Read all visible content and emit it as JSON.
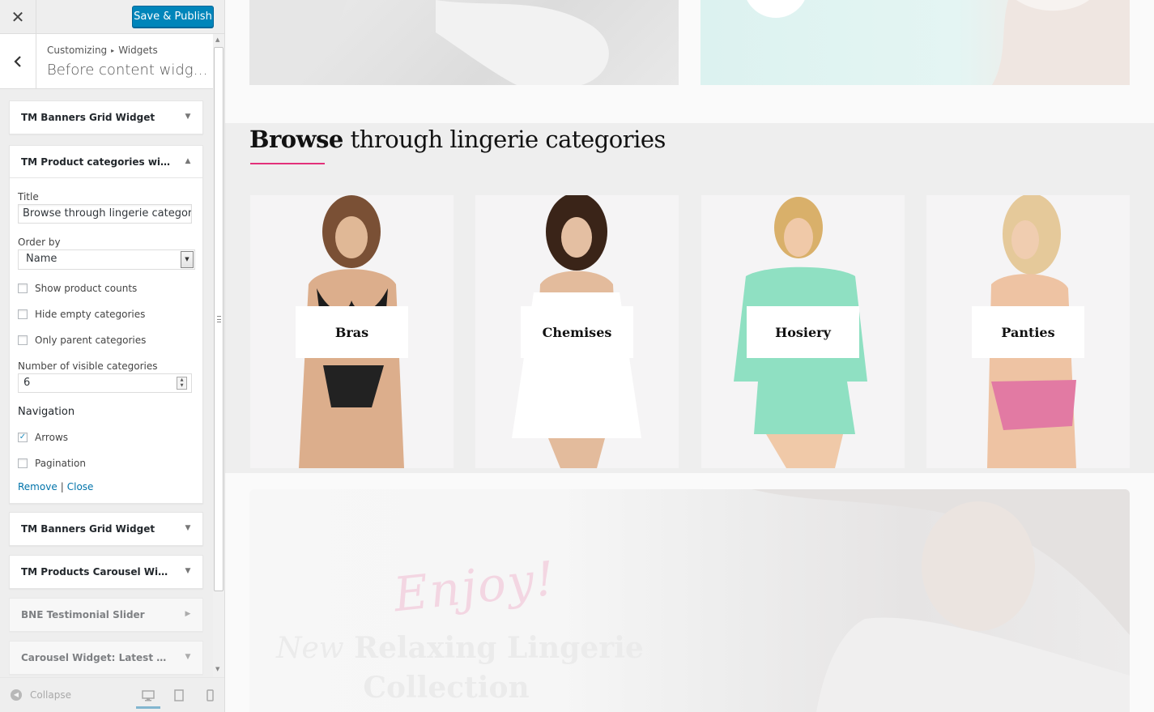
{
  "header": {
    "close_icon": "close-icon",
    "save_label": "Save & Publish"
  },
  "panel": {
    "breadcrumb_root": "Customizing",
    "breadcrumb_child": "Widgets",
    "title": "Before content widge..."
  },
  "widgets": [
    {
      "title": "TM Banners Grid Widget",
      "state": "collapsed"
    },
    {
      "title": "TM Product categories with t...",
      "state": "expanded"
    },
    {
      "title": "TM Banners Grid Widget",
      "state": "collapsed"
    },
    {
      "title": "TM Products Carousel Widget...",
      "state": "collapsed"
    },
    {
      "title": "BNE Testimonial Slider",
      "state": "collapsed"
    },
    {
      "title": "Carousel Widget: Latest blog ...",
      "state": "collapsed"
    }
  ],
  "form": {
    "title_label": "Title",
    "title_value": "Browse through lingerie categori",
    "order_label": "Order by",
    "order_value": "Name",
    "show_counts_label": "Show product counts",
    "show_counts_checked": false,
    "hide_empty_label": "Hide empty categories",
    "hide_empty_checked": false,
    "only_parent_label": "Only parent categories",
    "only_parent_checked": false,
    "visible_label": "Number of visible categories",
    "visible_value": "6",
    "navigation_heading": "Navigation",
    "arrows_label": "Arrows",
    "arrows_checked": true,
    "pagination_label": "Pagination",
    "pagination_checked": false,
    "remove_label": "Remove",
    "close_label": "Close"
  },
  "footer": {
    "collapse_label": "Collapse"
  },
  "preview": {
    "section_title_bold": "Browse",
    "section_title_rest": " through lingerie categories",
    "accent_color": "#e3307a",
    "categories": [
      {
        "label": "Bras"
      },
      {
        "label": "Chemises"
      },
      {
        "label": "Hosiery"
      },
      {
        "label": "Panties"
      }
    ],
    "promo": {
      "script": "Enjoy!",
      "line1_italic": "New",
      "line1_rest": " Relaxing Lingerie",
      "line2": "Collection"
    }
  },
  "colors": {
    "primary_button": "#0085ba",
    "link": "#0073aa",
    "accent": "#e3307a"
  }
}
